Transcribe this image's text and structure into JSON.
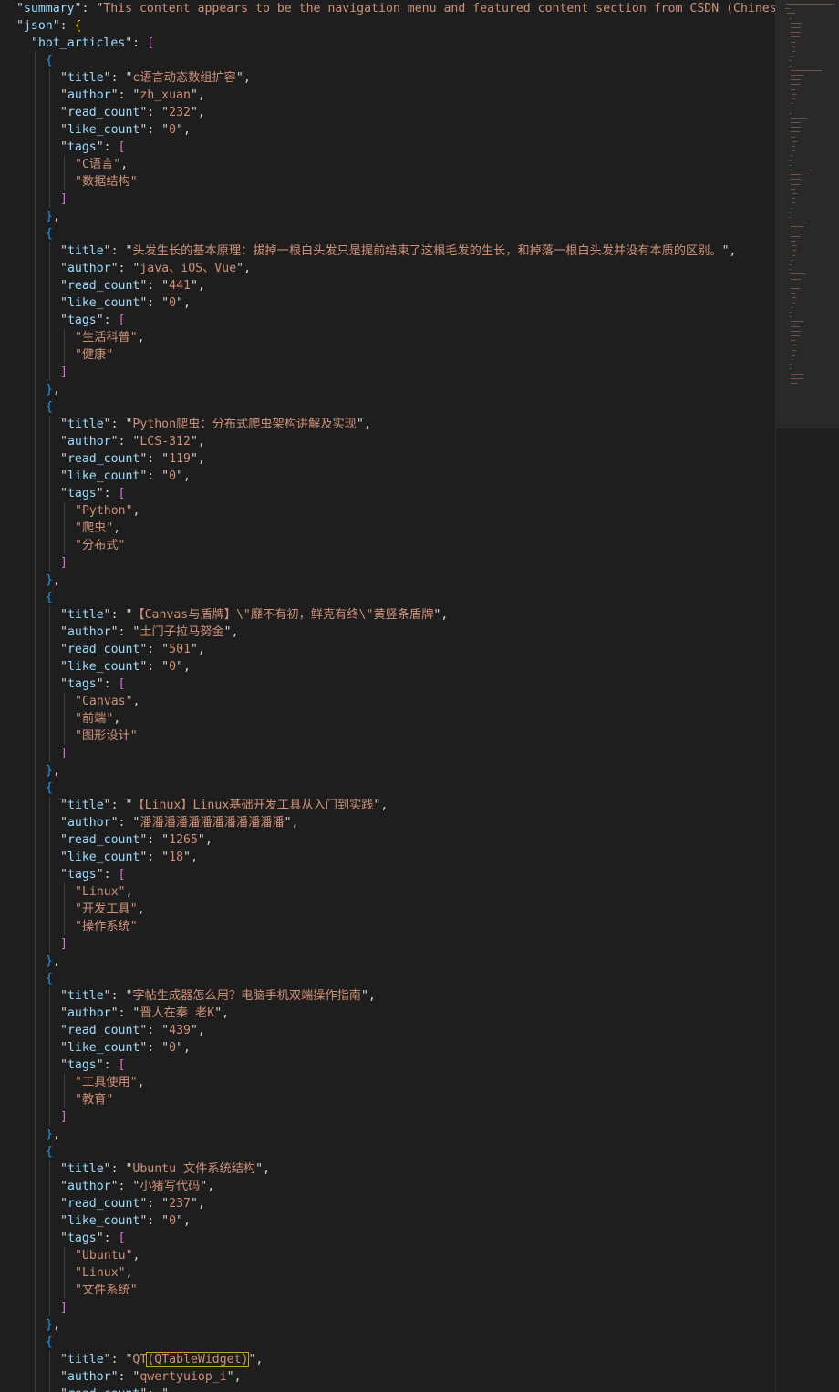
{
  "colors": {
    "background": "#1e1e1e",
    "key": "#9cdcfe",
    "string": "#ce9178",
    "punctuation": "#d4d4d4",
    "bracket_level_1": "#ffd700",
    "bracket_level_2": "#da70d6",
    "bracket_level_3": "#179fff"
  },
  "summary_key": "summary",
  "summary_value": "This content appears to be the navigation menu and featured content section from CSDN (Chinese S",
  "json_key": "json",
  "hot_articles_key": "hot_articles",
  "field_keys": {
    "title": "title",
    "author": "author",
    "read_count": "read_count",
    "like_count": "like_count",
    "tags": "tags"
  },
  "articles": [
    {
      "title": "c语言动态数组扩容",
      "author": "zh_xuan",
      "read_count": "232",
      "like_count": "0",
      "tags": [
        "C语言",
        "数据结构"
      ]
    },
    {
      "title": "头发生长的基本原理：拔掉一根白头发只是提前结束了这根毛发的生长，和掉落一根白头发并没有本质的区别。",
      "author": "java、iOS、Vue",
      "read_count": "441",
      "like_count": "0",
      "tags": [
        "生活科普",
        "健康"
      ]
    },
    {
      "title": "Python爬虫：分布式爬虫架构讲解及实现",
      "author": "LCS-312",
      "read_count": "119",
      "like_count": "0",
      "tags": [
        "Python",
        "爬虫",
        "分布式"
      ]
    },
    {
      "title": "【Canvas与盾牌】\\\"靡不有初，鲜克有终\\\"黄竖条盾牌",
      "author": "土门子拉马努金",
      "read_count": "501",
      "like_count": "0",
      "tags": [
        "Canvas",
        "前端",
        "图形设计"
      ]
    },
    {
      "title": "【Linux】Linux基础开发工具从入门到实践",
      "author": "潘潘潘潘潘潘潘潘潘潘潘潘",
      "read_count": "1265",
      "like_count": "18",
      "tags": [
        "Linux",
        "开发工具",
        "操作系统"
      ]
    },
    {
      "title": "字帖生成器怎么用？电脑手机双端操作指南",
      "author": "晋人在秦 老K",
      "read_count": "439",
      "like_count": "0",
      "tags": [
        "工具使用",
        "教育"
      ]
    },
    {
      "title": "Ubuntu 文件系统结构",
      "author": "小猪写代码",
      "read_count": "237",
      "like_count": "0",
      "tags": [
        "Ubuntu",
        "Linux",
        "文件系统"
      ]
    }
  ],
  "last_article_partial": {
    "title_prefix": "QT",
    "title_highlight": "(QTableWidget)",
    "author": "qwertyuiop_i"
  }
}
